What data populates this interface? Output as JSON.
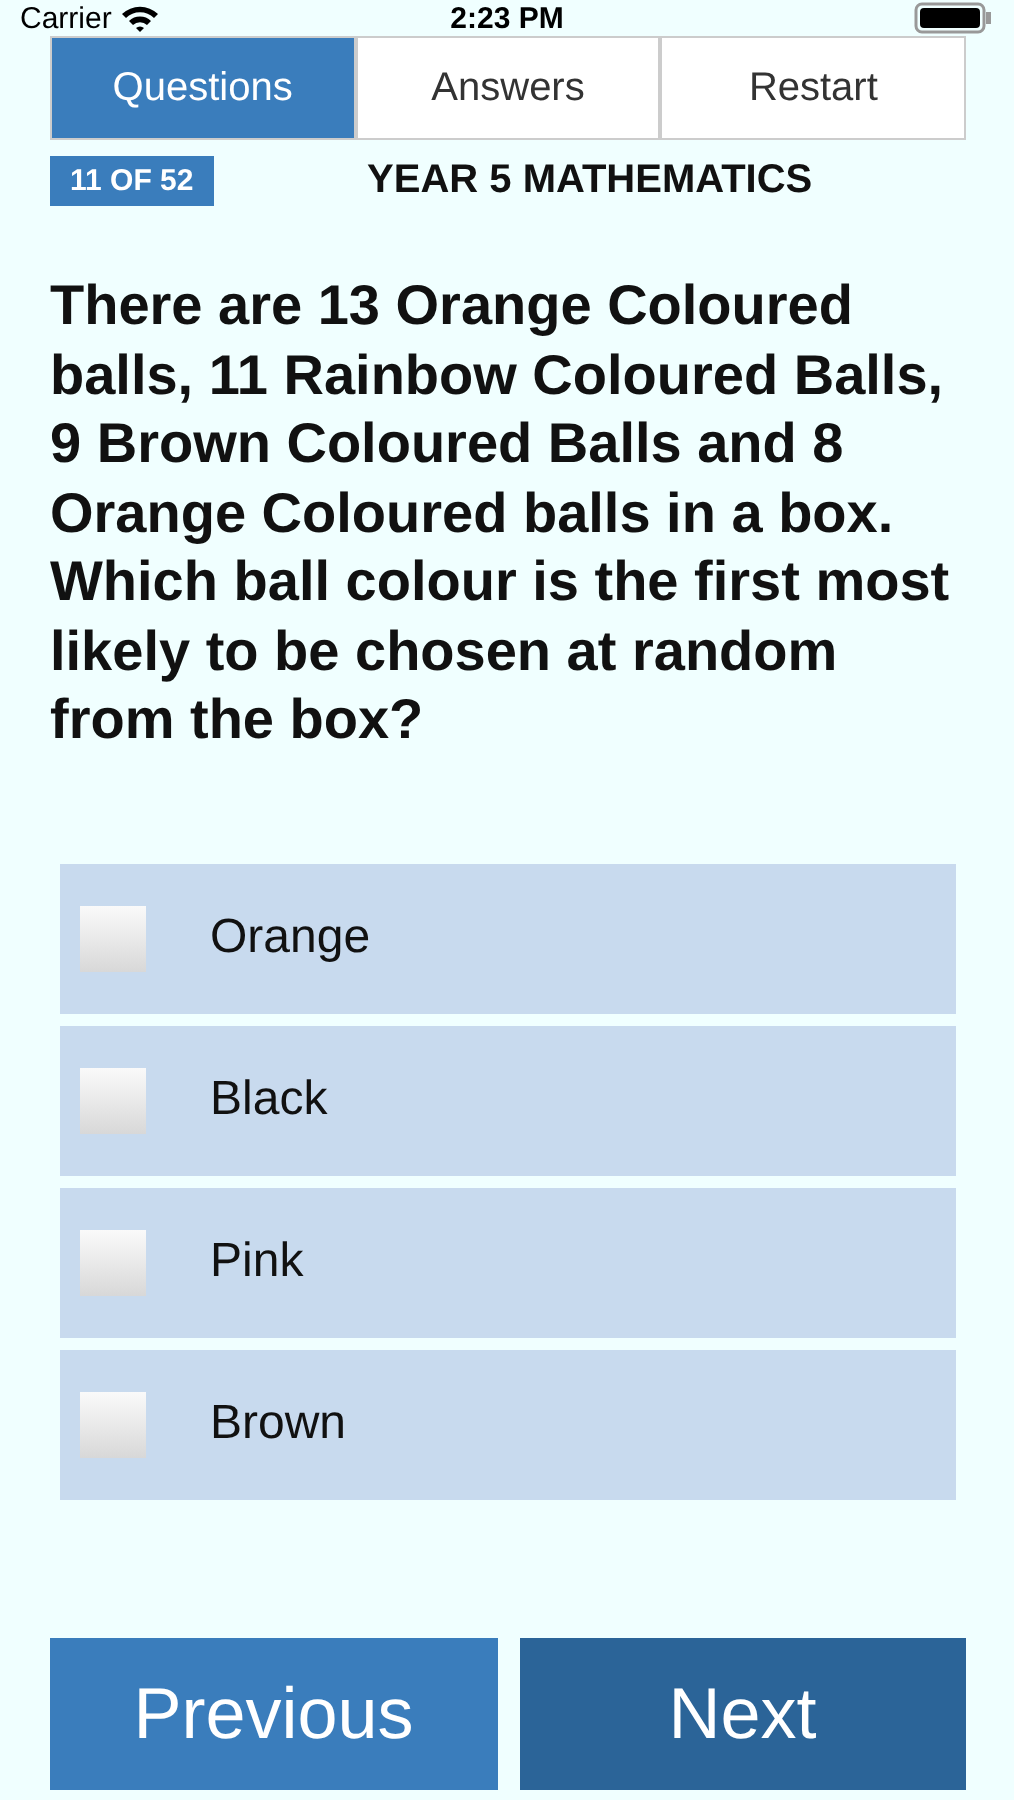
{
  "status_bar": {
    "carrier": "Carrier",
    "time": "2:23 PM"
  },
  "tabs": [
    {
      "label": "Questions",
      "selected": true
    },
    {
      "label": "Answers",
      "selected": false
    },
    {
      "label": "Restart",
      "selected": false
    }
  ],
  "counter": "11 OF 52",
  "subject": "YEAR 5 MATHEMATICS",
  "question": "There are 13 Orange Coloured balls, 11 Rainbow Coloured Balls, 9 Brown Coloured Balls and 8 Orange Coloured balls in a box. Which ball colour is the first most likely to be chosen at random from the box?",
  "options": [
    {
      "label": "Orange",
      "checked": false
    },
    {
      "label": "Black",
      "checked": false
    },
    {
      "label": "Pink",
      "checked": false
    },
    {
      "label": "Brown",
      "checked": false
    }
  ],
  "buttons": [
    {
      "label": "Previous",
      "kind": "secondary"
    },
    {
      "label": "Next",
      "kind": "primary"
    }
  ]
}
